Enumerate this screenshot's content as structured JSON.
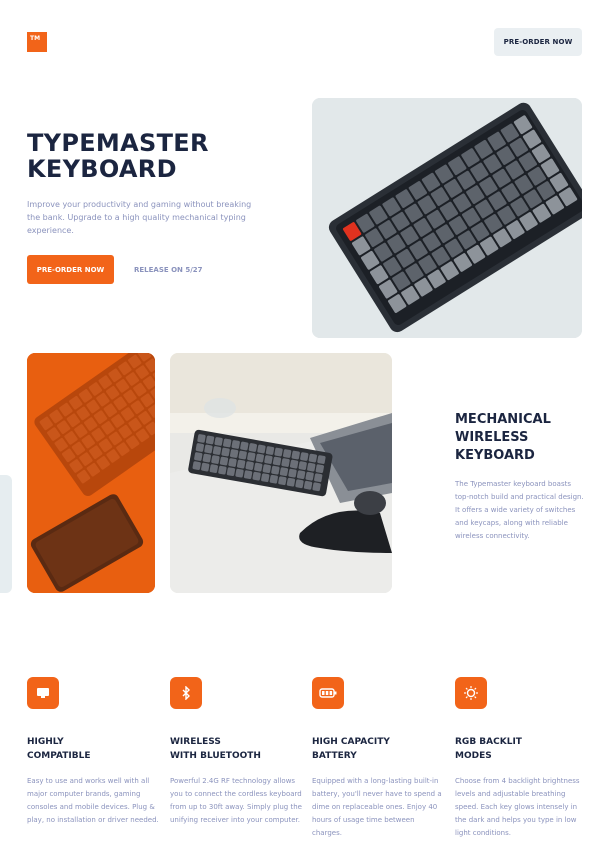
{
  "header": {
    "logo_text": "TM",
    "nav_button": "PRE-ORDER NOW"
  },
  "hero": {
    "title_line1": "TYPEMASTER",
    "title_line2": "KEYBOARD",
    "description": "Improve your productivity and gaming without breaking the bank. Upgrade to a high quality mechanical typing experience.",
    "cta_label": "PRE-ORDER NOW",
    "release_label": "RELEASE ON 5/27"
  },
  "feature": {
    "title_line1": "MECHANICAL",
    "title_line2": "WIRELESS",
    "title_line3": "KEYBOARD",
    "description": "The Typemaster keyboard boasts top-notch build and practical design. It offers a wide variety of switches and keycaps, along with reliable wireless connectivity."
  },
  "cards": [
    {
      "icon": "monitor-icon",
      "title_line1": "HIGHLY",
      "title_line2": "COMPATIBLE",
      "description": "Easy to use and works well with all major computer brands, gaming consoles and mobile devices. Plug & play, no installation or driver needed."
    },
    {
      "icon": "bluetooth-icon",
      "title_line1": "WIRELESS",
      "title_line2": "WITH BLUETOOTH",
      "description": "Powerful 2.4G RF technology allows you to connect the cordless keyboard from up to 30ft away. Simply plug the unifying receiver into your computer."
    },
    {
      "icon": "battery-icon",
      "title_line1": "HIGH CAPACITY",
      "title_line2": "BATTERY",
      "description": "Equipped with a long-lasting built-in battery, you'll never have to spend a dime on replaceable ones. Enjoy 40 hours of usage time between charges."
    },
    {
      "icon": "lightbulb-icon",
      "title_line1": "RGB BACKLIT",
      "title_line2": "MODES",
      "description": "Choose from 4 backlight brightness levels and adjustable breathing speed. Each key glows intensely in the dark and helps you type in low light conditions."
    }
  ],
  "colors": {
    "accent": "#f26419",
    "navy": "#1b2540",
    "muted": "#8b93bd",
    "light": "#eaeff2"
  }
}
